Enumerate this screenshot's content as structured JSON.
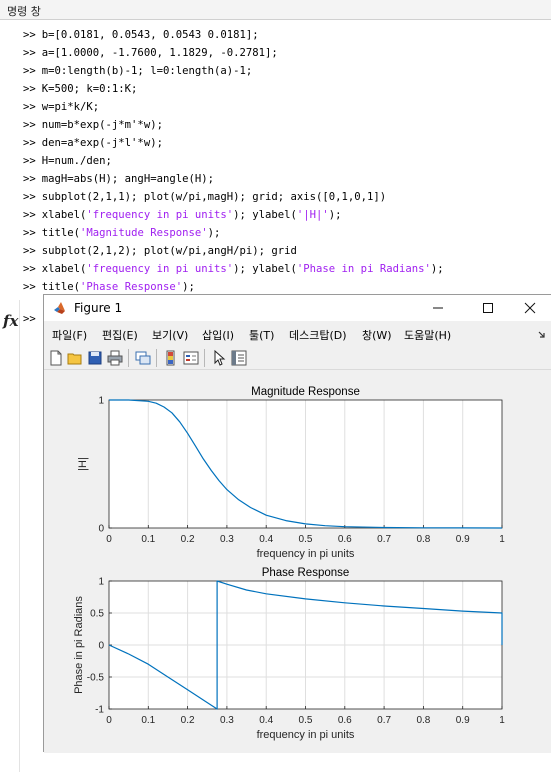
{
  "command_window": {
    "title": "명령 창",
    "prompt": ">>",
    "lines": [
      {
        "code": "b=[0.0181, 0.0543, 0.0543 0.0181];"
      },
      {
        "code": "a=[1.0000, -1.7600, 1.1829, -0.2781];"
      },
      {
        "code": "m=0:length(b)-1; l=0:length(a)-1;"
      },
      {
        "code": "K=500; k=0:1:K;"
      },
      {
        "code": "w=pi*k/K;"
      },
      {
        "code": "num=b*exp(-j*m'*w);"
      },
      {
        "code": "den=a*exp(-j*l'*w);"
      },
      {
        "code": "H=num./den;"
      },
      {
        "code": "magH=abs(H); angH=angle(H);"
      },
      {
        "code": "subplot(2,1,1); plot(w/pi,magH); grid; axis([0,1,0,1])"
      },
      {
        "code": "xlabel(",
        "s1": "'frequency in pi units'",
        "mid": "); ylabel(",
        "s2": "'|H|'",
        "end": ");"
      },
      {
        "code": "title(",
        "s1": "'Magnitude Response'",
        "mid": ");",
        "s2": "",
        "end": ""
      },
      {
        "code": "subplot(2,1,2); plot(w/pi,angH/pi); grid"
      },
      {
        "code": "xlabel(",
        "s1": "'frequency in pi units'",
        "mid": "); ylabel(",
        "s2": "'Phase in pi Radians'",
        "end": ");"
      },
      {
        "code": "title(",
        "s1": "'Phase Response'",
        "mid": ");",
        "s2": "",
        "end": ""
      }
    ],
    "fx_label": "fx"
  },
  "figure": {
    "title": "Figure 1",
    "menu": [
      "파일(F)",
      "편집(E)",
      "보기(V)",
      "삽입(I)",
      "툴(T)",
      "데스크탑(D)",
      "창(W)",
      "도움말(H)"
    ],
    "toolbar_icons": [
      "new-figure-icon",
      "open-file-icon",
      "save-icon",
      "print-icon",
      "link-plot-icon",
      "colorbar-icon",
      "legend-icon",
      "pointer-icon",
      "property-editor-icon"
    ],
    "colors": {
      "line": "#0072bd",
      "grid": "#dfdfdf",
      "axes_bg": "#ffffff"
    }
  },
  "chart_data": [
    {
      "type": "line",
      "title": "Magnitude Response",
      "xlabel": "frequency in pi units",
      "ylabel": "|H|",
      "xlim": [
        0,
        1
      ],
      "ylim": [
        0,
        1
      ],
      "xticks": [
        "0",
        "0.1",
        "0.2",
        "0.3",
        "0.4",
        "0.5",
        "0.6",
        "0.7",
        "0.8",
        "0.9",
        "1"
      ],
      "yticks": [
        "0",
        "1"
      ],
      "grid": true,
      "series": [
        {
          "x": [
            0,
            0.05,
            0.1,
            0.12,
            0.14,
            0.16,
            0.18,
            0.2,
            0.22,
            0.24,
            0.26,
            0.28,
            0.3,
            0.33,
            0.36,
            0.4,
            0.45,
            0.5,
            0.55,
            0.6,
            0.7,
            0.8,
            0.9,
            1.0
          ],
          "y": [
            1.0,
            1.0,
            0.99,
            0.975,
            0.945,
            0.9,
            0.83,
            0.74,
            0.64,
            0.54,
            0.45,
            0.37,
            0.3,
            0.22,
            0.16,
            0.1,
            0.058,
            0.032,
            0.018,
            0.01,
            0.004,
            0.0015,
            0.0005,
            0.0
          ]
        }
      ]
    },
    {
      "type": "line",
      "title": "Phase Response",
      "xlabel": "frequency in pi units",
      "ylabel": "Phase in pi Radians",
      "xlim": [
        0,
        1
      ],
      "ylim": [
        -1,
        1
      ],
      "xticks": [
        "0",
        "0.1",
        "0.2",
        "0.3",
        "0.4",
        "0.5",
        "0.6",
        "0.7",
        "0.8",
        "0.9",
        "1"
      ],
      "yticks": [
        "-1",
        "-0.5",
        "0",
        "0.5",
        "1"
      ],
      "grid": true,
      "series": [
        {
          "x": [
            0,
            0.05,
            0.1,
            0.15,
            0.2,
            0.25,
            0.275,
            0.275,
            0.3,
            0.35,
            0.4,
            0.5,
            0.6,
            0.7,
            0.8,
            0.9,
            1.0,
            1.0
          ],
          "y": [
            0,
            -0.14,
            -0.3,
            -0.5,
            -0.7,
            -0.9,
            -1.0,
            1.0,
            0.95,
            0.86,
            0.8,
            0.72,
            0.66,
            0.61,
            0.57,
            0.53,
            0.5,
            0.0
          ]
        }
      ]
    }
  ]
}
